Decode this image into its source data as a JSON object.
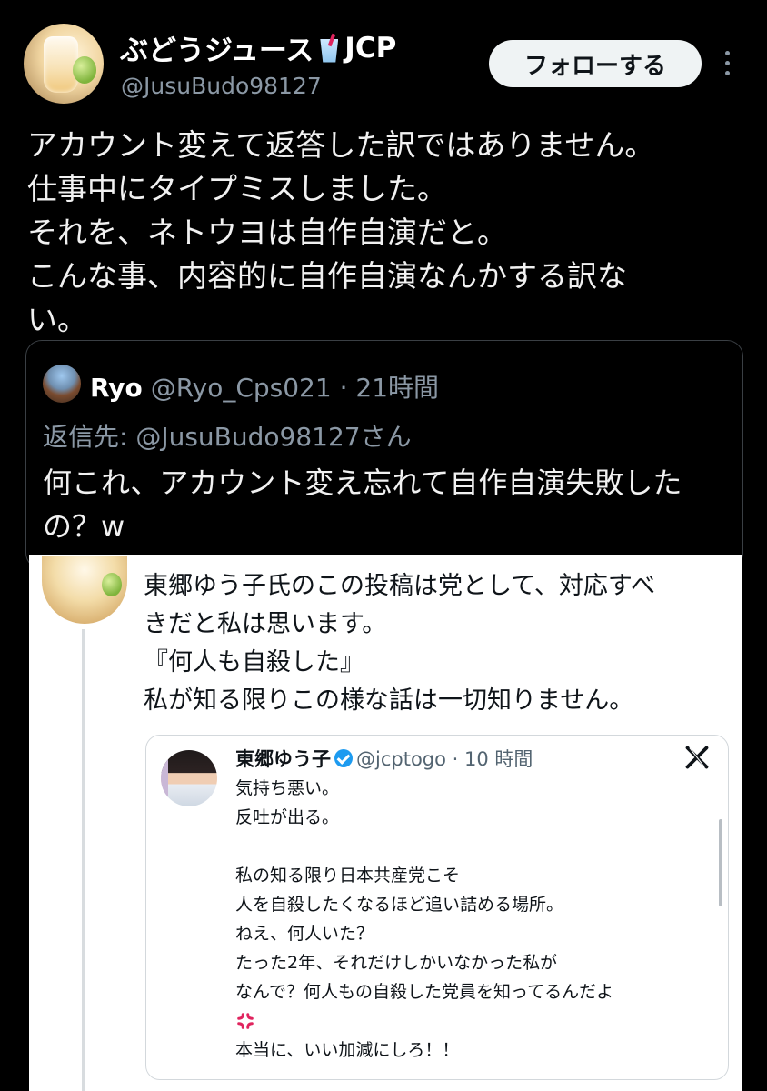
{
  "tweet": {
    "display_name": "ぶどうジュース",
    "party_tag": "JCP",
    "handle": "@JusuBudo98127",
    "follow_label": "フォローする",
    "lines": [
      "アカウント変えて返答した訳ではありません。",
      "仕事中にタイプミスしました。",
      "それを、ネトウヨは自作自演だと。",
      "こんな事、内容的に自作自演なんかする訳な",
      "い。"
    ]
  },
  "quote": {
    "name": "Ryo",
    "meta": "@Ryo_Cps021 · 21時間",
    "reply_to": "返信先: @JusuBudo98127さん",
    "lines": [
      "何これ、アカウント変え忘れて自作自演失敗した",
      "の？w"
    ]
  },
  "screenshot": {
    "lines": [
      "東郷ゆう子氏のこの投稿は党として、対応すべ",
      "きだと私は思います。",
      "『何人も自殺した』",
      "私が知る限りこの様な話は一切知りません。"
    ],
    "embedded": {
      "name": "東郷ゆう子",
      "meta": "@jcptogo · 10 時間",
      "lines": [
        "気持ち悪い。",
        "反吐が出る。",
        "",
        "私の知る限り日本共産党こそ",
        "人を自殺したくなるほど追い詰める場所。",
        "ねえ、何人いた？",
        "たった2年、それだけしかいなかった私が",
        "なんで？何人もの自殺した党員を知ってるんだよ",
        "",
        "本当に、いい加減にしろ！！"
      ]
    }
  },
  "icons": {
    "cup": "cup-with-straw-icon",
    "more": "more-vertical-icon",
    "verified": "verified-badge-icon",
    "x_logo": "x-logo-icon",
    "anger": "anger-symbol-icon"
  },
  "colors": {
    "background": "#000000",
    "secondary_text": "#8b98a5",
    "follow_button_bg": "#eff3f4",
    "verified_blue": "#1d9bf0",
    "anger_red": "#e0245e"
  }
}
